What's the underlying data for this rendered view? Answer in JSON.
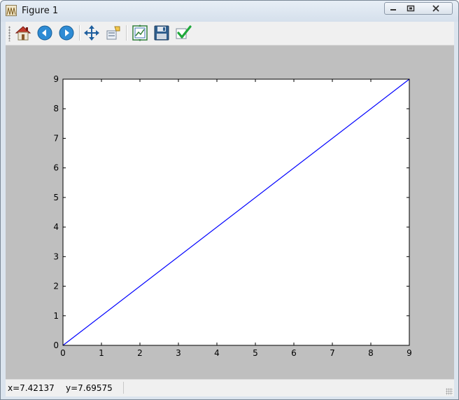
{
  "window": {
    "title": "Figure 1",
    "app_icon": "matplotlib-figure-icon",
    "controls": [
      "minimize-icon",
      "restore-icon",
      "close-icon"
    ]
  },
  "toolbar": {
    "tools": [
      {
        "name": "home",
        "icon": "home-icon"
      },
      {
        "name": "back",
        "icon": "arrow-left-icon"
      },
      {
        "name": "forward",
        "icon": "arrow-right-icon"
      },
      {
        "name": "pan",
        "icon": "move-arrows-icon"
      },
      {
        "name": "zoom",
        "icon": "zoom-rect-icon"
      },
      {
        "name": "subplots",
        "icon": "subplot-config-icon"
      },
      {
        "name": "save",
        "icon": "floppy-disk-icon"
      },
      {
        "name": "edit",
        "icon": "checkmark-icon"
      }
    ]
  },
  "chart_data": {
    "type": "line",
    "x": [
      0,
      9
    ],
    "y": [
      0,
      9
    ],
    "series": [
      {
        "x": [
          0,
          9
        ],
        "values": [
          0,
          9
        ],
        "color": "#0000ff"
      }
    ],
    "xlim": [
      0,
      9
    ],
    "ylim": [
      0,
      9
    ],
    "xticks": [
      "0",
      "1",
      "2",
      "3",
      "4",
      "5",
      "6",
      "7",
      "8",
      "9"
    ],
    "yticks": [
      "0",
      "1",
      "2",
      "3",
      "4",
      "5",
      "6",
      "7",
      "8",
      "9"
    ],
    "grid": false,
    "title": "",
    "xlabel": "",
    "ylabel": ""
  },
  "status": {
    "x_readout": "x=7.42137",
    "y_readout": "y=7.69575"
  },
  "colors": {
    "figure_background": "#bfbfbf",
    "axes_background": "#ffffff",
    "line": "#0000ff"
  }
}
